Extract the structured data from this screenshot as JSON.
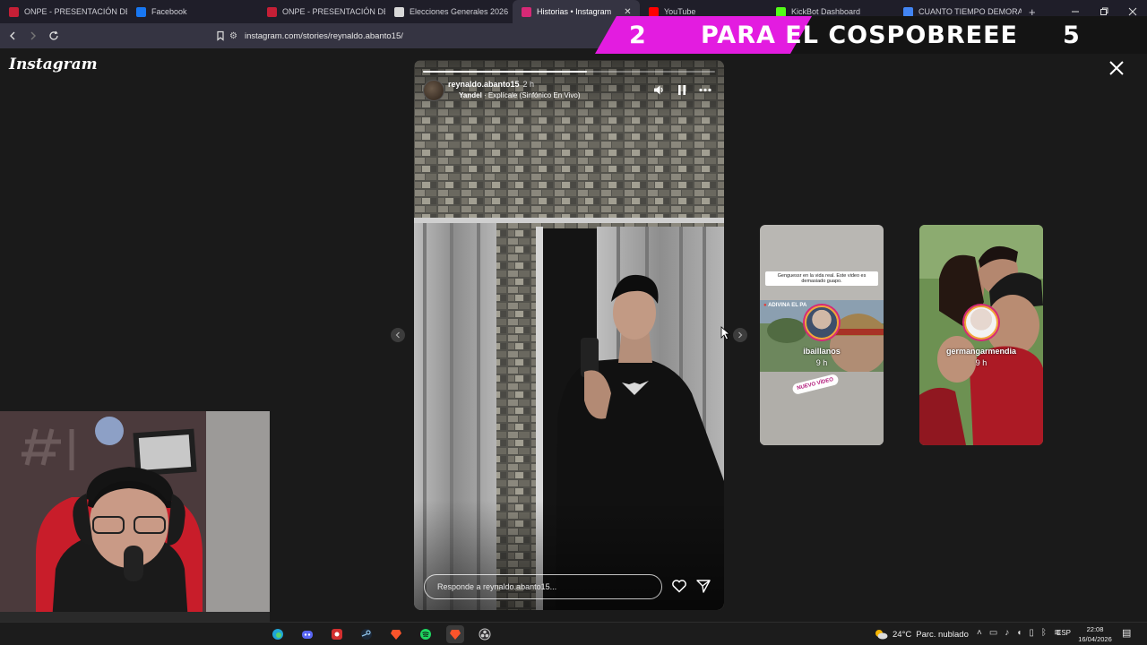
{
  "browser": {
    "tabs": [
      {
        "title": "ONPE - PRESENTACIÓN DE RE",
        "favicon_color": "#c51f36",
        "width": 142
      },
      {
        "title": "Facebook",
        "favicon_color": "#1877f2",
        "width": 146
      },
      {
        "title": "ONPE - PRESENTACIÓN DE RE",
        "favicon_color": "#c51f36",
        "width": 142
      },
      {
        "title": "Elecciones Generales 2026",
        "favicon_color": "#d8d8d8",
        "width": 142
      },
      {
        "title": "Historias • Instagram",
        "favicon_color": "#d62976",
        "width": 142,
        "active": true
      },
      {
        "title": "YouTube",
        "favicon_color": "#ff0000",
        "width": 142
      },
      {
        "title": "KickBot Dashboard",
        "favicon_color": "#53fc18",
        "width": 142
      },
      {
        "title": "CUANTO TIEMPO DEMORA UN",
        "favicon_color": "#4285f4",
        "width": 142
      }
    ],
    "new_tab_glyph": "+",
    "url": "instagram.com/stories/reynaldo.abanto15/"
  },
  "overlay": {
    "left_text": "2",
    "center_text": "PARA EL COSPOBREEE",
    "right_text": "5",
    "accent": "#e31ce0"
  },
  "instagram": {
    "logo": "Instagram",
    "story": {
      "username": "reynaldo.abanto15",
      "time": "2 h",
      "song_artist": "Yandel",
      "song_title": " · Explícale (Sinfónico En Vivo)",
      "progress": 0.56,
      "reply_placeholder": "Responde a reynaldo.abanto15..."
    },
    "next_stories": [
      {
        "username": "ibaillanos",
        "time": "9 h",
        "caption": "Genguessr en la vida real. Este video es demasiado guapo.",
        "location": "ADIVINA EL PA",
        "sticker": "NUEVO VÍDEO"
      },
      {
        "username": "germangarmendia",
        "time": "9 h"
      }
    ]
  },
  "taskbar": {
    "weather_temp": "24°C",
    "weather_text": "Parc. nublado",
    "language": "ESP",
    "time": "22:08",
    "date": "16/04/2026"
  }
}
